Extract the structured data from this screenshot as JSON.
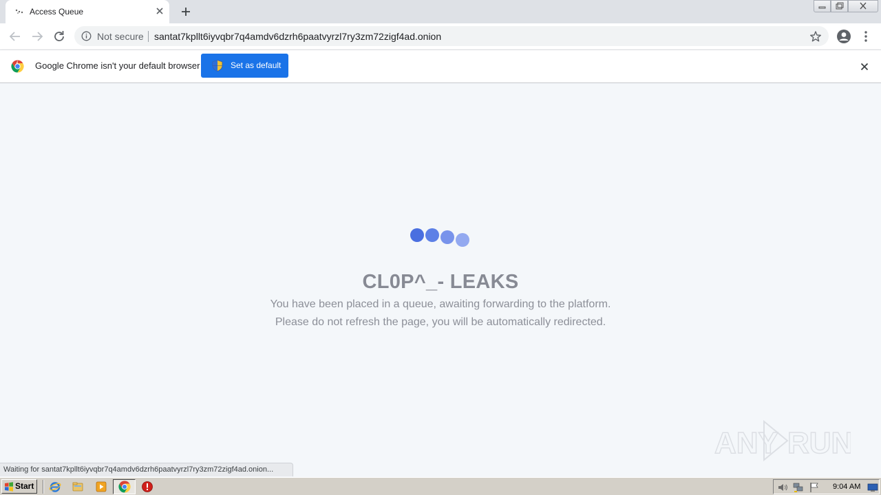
{
  "browser": {
    "tab": {
      "title": "Access Queue",
      "favicon": "loading-dots-icon"
    },
    "window_buttons": [
      "minimize",
      "restore",
      "close"
    ],
    "omnibox": {
      "security_label": "Not secure",
      "url": "santat7kpllt6iyvqbr7q4amdv6dzrh6paatvyrzl7ry3zm72zigf4ad.onion"
    },
    "infobar": {
      "message": "Google Chrome isn't your default browser",
      "button_label": "Set as default"
    },
    "status_bubble": "Waiting for santat7kpllt6iyvqbr7q4amdv6dzrh6paatvyrzl7ry3zm72zigf4ad.onion..."
  },
  "page": {
    "loader_colors": [
      "#4a6fe0",
      "#5d80e6",
      "#7893eb",
      "#93a9f0"
    ],
    "headline": "CL0P^_- LEAKS",
    "message_line1": "You have been placed in a queue, awaiting forwarding to the platform.",
    "message_line2": "Please do not refresh the page, you will be automatically redirected."
  },
  "watermark": {
    "text": "ANY RUN"
  },
  "taskbar": {
    "start_label": "Start",
    "quicklaunch": [
      "internet-explorer-icon",
      "file-explorer-icon",
      "media-player-icon",
      "chrome-icon",
      "stop-icon"
    ],
    "tray_icons": [
      "volume-icon",
      "network-icon",
      "flag-icon",
      "display-icon"
    ],
    "clock": "9:04 AM"
  },
  "colors": {
    "accent": "#1a73e8",
    "headline": "#878a94",
    "page_background": "#f4f7fa"
  }
}
